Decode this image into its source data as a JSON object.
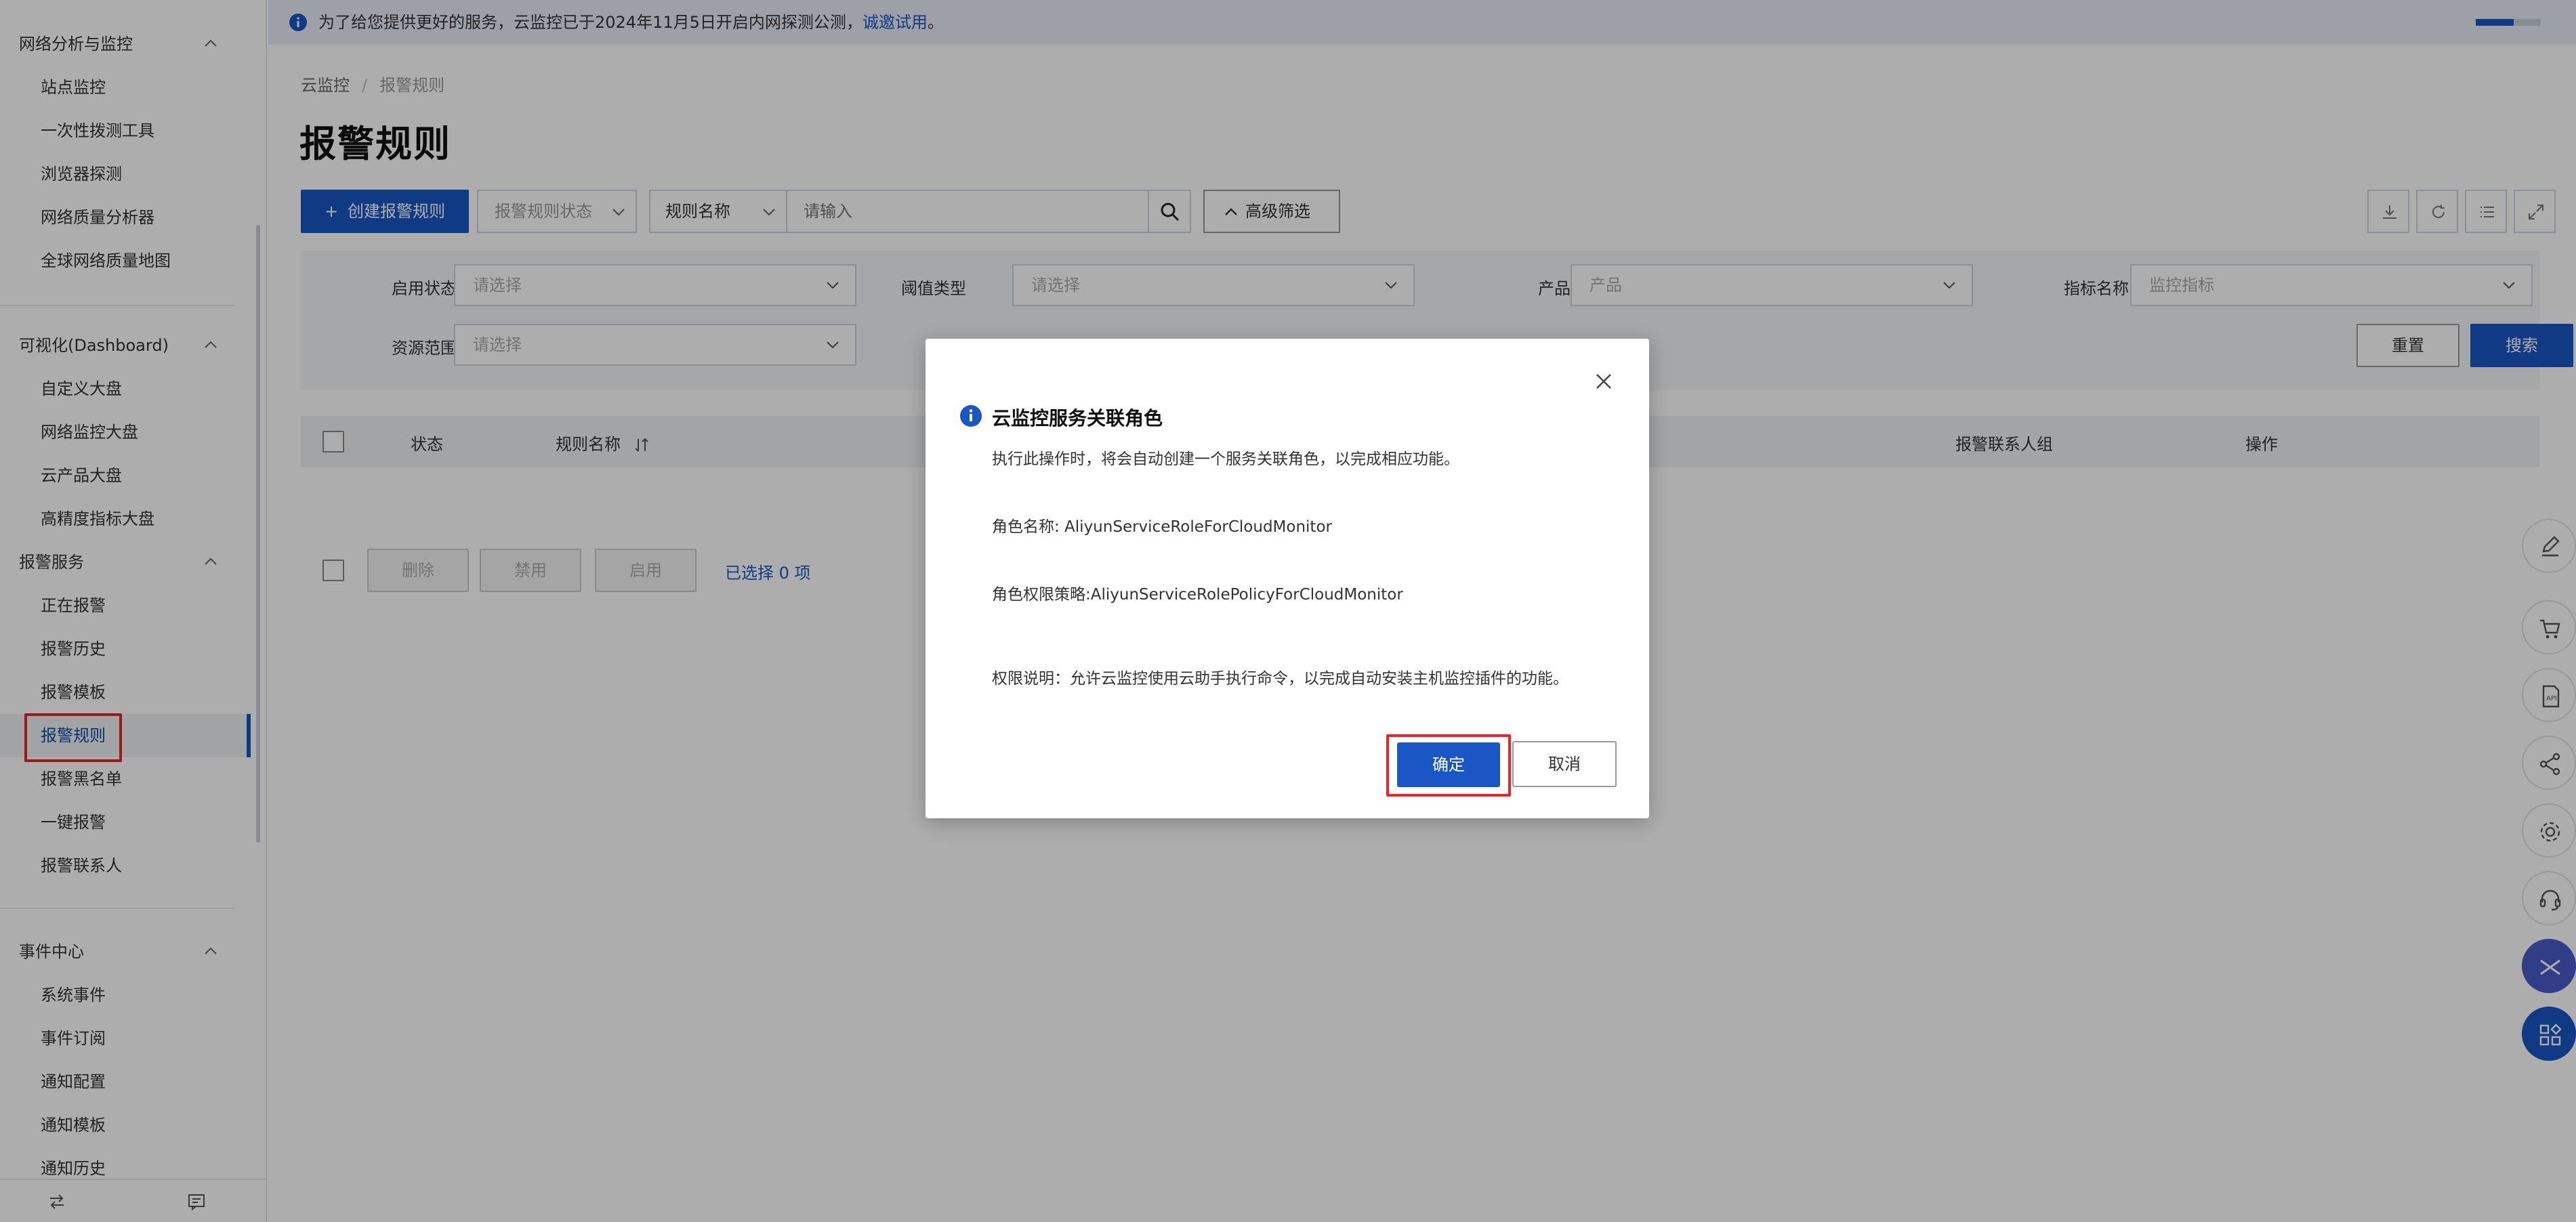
{
  "sidebar": {
    "groups": [
      {
        "title": "网络分析与监控",
        "items": [
          "站点监控",
          "一次性拨测工具",
          "浏览器探测",
          "网络质量分析器",
          "全球网络质量地图"
        ]
      },
      {
        "title": "可视化(Dashboard)",
        "items": [
          "自定义大盘",
          "网络监控大盘",
          "云产品大盘",
          "高精度指标大盘"
        ]
      },
      {
        "title": "报警服务",
        "items": [
          "正在报警",
          "报警历史",
          "报警模板",
          "报警规则",
          "报警黑名单",
          "一键报警",
          "报警联系人"
        ]
      },
      {
        "title": "事件中心",
        "items": [
          "系统事件",
          "事件订阅",
          "通知配置",
          "通知模板",
          "通知历史"
        ]
      }
    ],
    "active_item": "报警规则"
  },
  "notice": {
    "text": "为了给您提供更好的服务，云监控已于2024年11月5日开启内网探测公测，",
    "link": "诚邀试用",
    "suffix": "。",
    "progress": 0.58
  },
  "breadcrumb": {
    "root": "云监控",
    "sep": "/",
    "current": "报警规则"
  },
  "page_title": "报警规则",
  "toolbar": {
    "create_label": "创建报警规则",
    "create_plus": "+",
    "status_select": "报警规则状态",
    "field_select": "规则名称",
    "search_placeholder": "请输入",
    "advanced_filter": "高级筛选"
  },
  "filters": {
    "enable_status": {
      "label": "启用状态",
      "placeholder": "请选择"
    },
    "threshold_type": {
      "label": "阈值类型",
      "placeholder": "请选择"
    },
    "product": {
      "label": "产品",
      "placeholder": "产品"
    },
    "metric_name": {
      "label": "指标名称",
      "placeholder": "监控指标"
    },
    "resource_scope": {
      "label": "资源范围",
      "placeholder": "请选择"
    },
    "reset_label": "重置",
    "search_label": "搜索"
  },
  "table": {
    "columns": {
      "status": "状态",
      "rule_name": "规则名称",
      "contact_group": "报警联系人组",
      "actions": "操作"
    }
  },
  "batch": {
    "delete": "删除",
    "disable": "禁用",
    "enable": "启用",
    "selected": "已选择 0 项"
  },
  "modal": {
    "title": "云监控服务关联角色",
    "description": "执行此操作时，将会自动创建一个服务关联角色，以完成相应功能。",
    "role_name": "角色名称: AliyunServiceRoleForCloudMonitor",
    "role_policy": "角色权限策略:AliyunServiceRolePolicyForCloudMonitor",
    "permission_note": "权限说明：允许云监控使用云助手执行命令，以完成自动安装主机监控插件的功能。",
    "confirm_label": "确定",
    "cancel_label": "取消"
  },
  "colors": {
    "primary": "#1a56c4",
    "highlight": "#e5262c",
    "notice_bg": "#e8edf6"
  }
}
